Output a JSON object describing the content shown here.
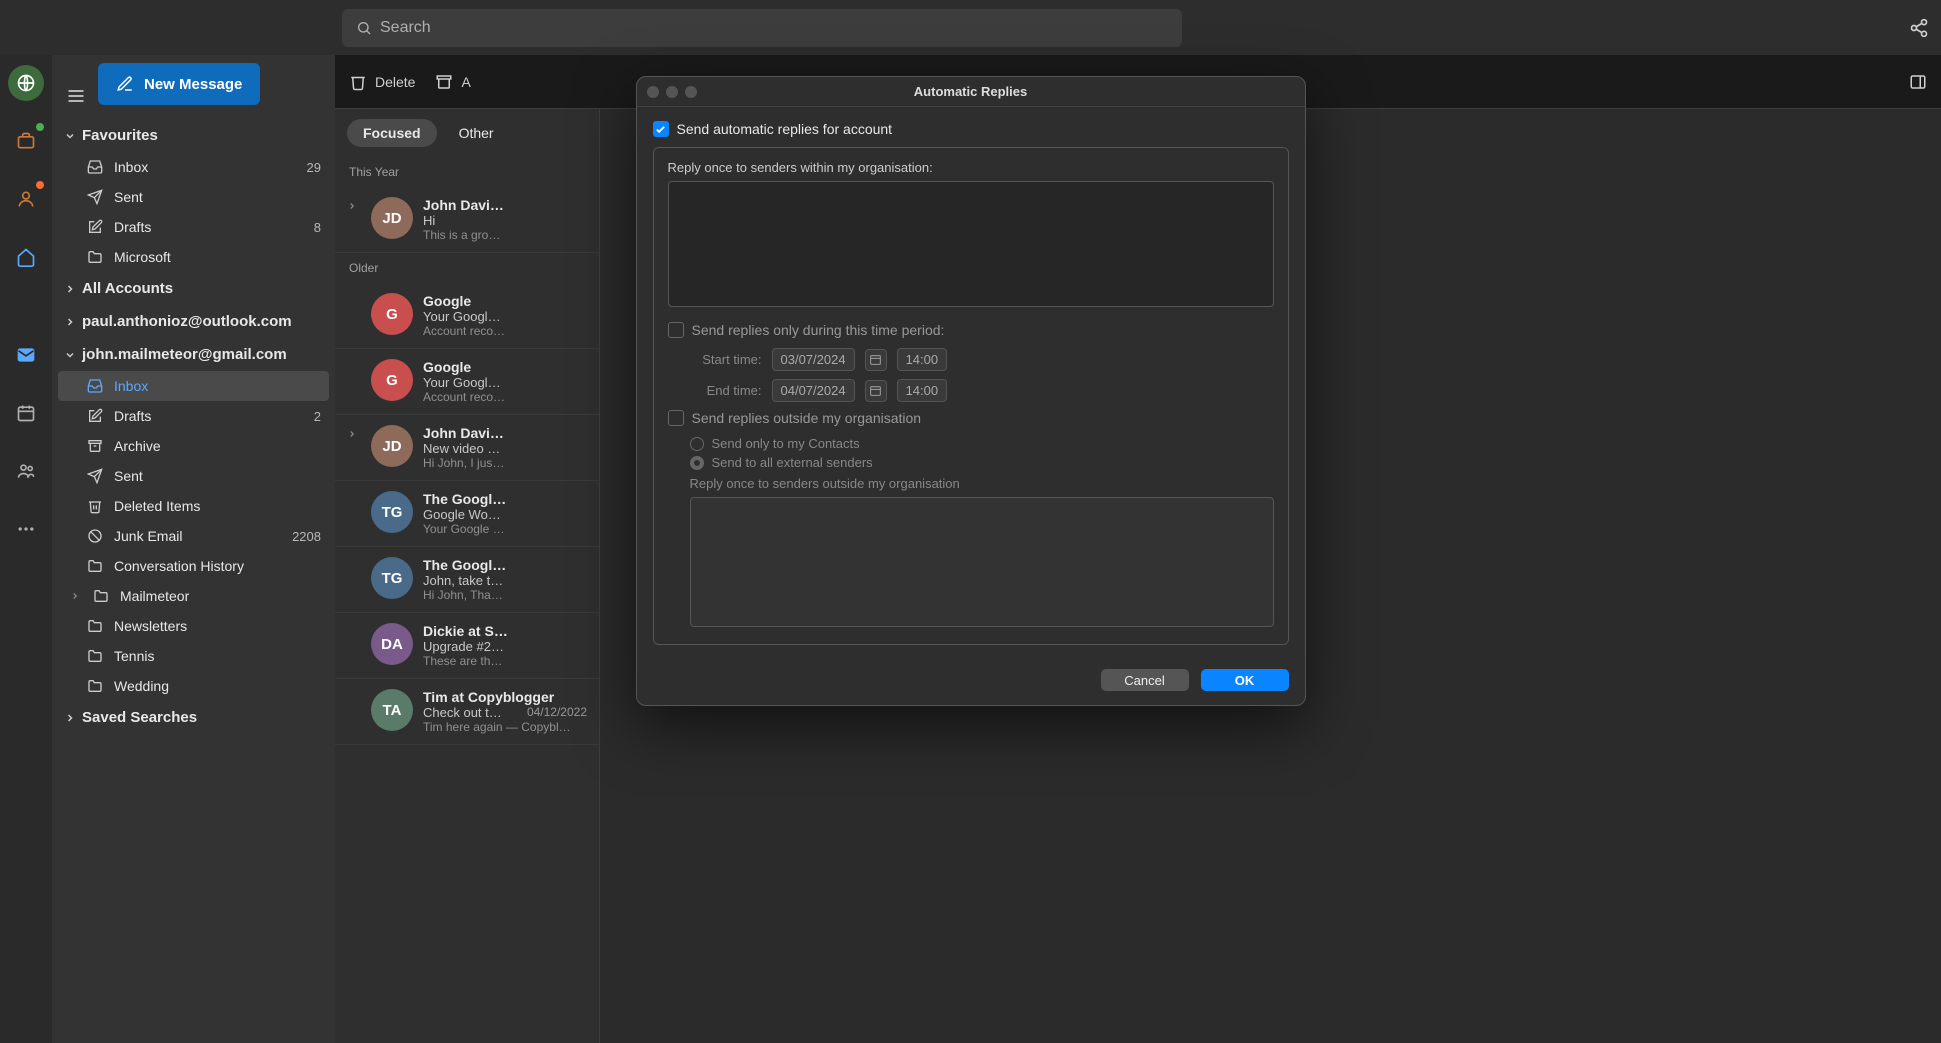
{
  "topbar": {
    "search_placeholder": "Search"
  },
  "compose": {
    "new_message": "New Message"
  },
  "toolbar": {
    "delete": "Delete",
    "archive_prefix": "A"
  },
  "sidebar": {
    "favourites": {
      "label": "Favourites",
      "items": [
        {
          "label": "Inbox",
          "count": "29"
        },
        {
          "label": "Sent"
        },
        {
          "label": "Drafts",
          "count": "8"
        },
        {
          "label": "Microsoft"
        }
      ]
    },
    "all_accounts": {
      "label": "All Accounts"
    },
    "acct_paul": {
      "label": "paul.anthonioz@outlook.com"
    },
    "acct_john": {
      "label": "john.mailmeteor@gmail.com",
      "items": [
        {
          "label": "Inbox"
        },
        {
          "label": "Drafts",
          "count": "2"
        },
        {
          "label": "Archive"
        },
        {
          "label": "Sent"
        },
        {
          "label": "Deleted Items"
        },
        {
          "label": "Junk Email",
          "count": "2208"
        },
        {
          "label": "Conversation History"
        },
        {
          "label": "Mailmeteor"
        },
        {
          "label": "Newsletters"
        },
        {
          "label": "Tennis"
        },
        {
          "label": "Wedding"
        }
      ]
    },
    "saved_searches": {
      "label": "Saved Searches"
    }
  },
  "tabs": {
    "focused": "Focused",
    "other": "Other"
  },
  "sections": {
    "this_year": "This Year",
    "older": "Older"
  },
  "messages": [
    {
      "initials": "JD",
      "color": "#8d6a5a",
      "sender": "John Davi…",
      "subject": "Hi",
      "preview": "This is a gro…",
      "has_chevron": true
    },
    {
      "initials": "G",
      "color": "#c94f4f",
      "sender": "Google",
      "subject": "Your Googl…",
      "preview": "Account reco…"
    },
    {
      "initials": "G",
      "color": "#c94f4f",
      "sender": "Google",
      "subject": "Your Googl…",
      "preview": "Account reco…"
    },
    {
      "initials": "JD",
      "color": "#8d6a5a",
      "sender": "John Davi…",
      "subject": "New video …",
      "preview": "Hi John, I jus…",
      "has_chevron": true
    },
    {
      "initials": "TG",
      "color": "#4a6a8a",
      "sender": "The Googl…",
      "subject": "Google Wo…",
      "preview": "Your Google …"
    },
    {
      "initials": "TG",
      "color": "#4a6a8a",
      "sender": "The Googl…",
      "subject": "John, take t…",
      "preview": "Hi John, Tha…"
    },
    {
      "initials": "DA",
      "color": "#7a5a8a",
      "sender": "Dickie at S…",
      "subject": "Upgrade #2…",
      "preview": "These are th…"
    },
    {
      "initials": "TA",
      "color": "#5a7a6a",
      "sender": "Tim at Copyblogger",
      "subject": "Check out t…",
      "date": "04/12/2022",
      "preview": "Tim here again — Copybl…"
    }
  ],
  "modal": {
    "title": "Automatic Replies",
    "send_auto": "Send automatic replies for account",
    "reply_within": "Reply once to senders within my organisation:",
    "time_period": "Send replies only during this time period:",
    "start_label": "Start time:",
    "end_label": "End time:",
    "start_date": "03/07/2024",
    "end_date": "04/07/2024",
    "start_time": "14:00",
    "end_time": "14:00",
    "outside_org": "Send replies outside my organisation",
    "only_contacts": "Send only to my Contacts",
    "all_external": "Send to all external senders",
    "reply_outside": "Reply once to senders outside my organisation",
    "cancel": "Cancel",
    "ok": "OK"
  }
}
